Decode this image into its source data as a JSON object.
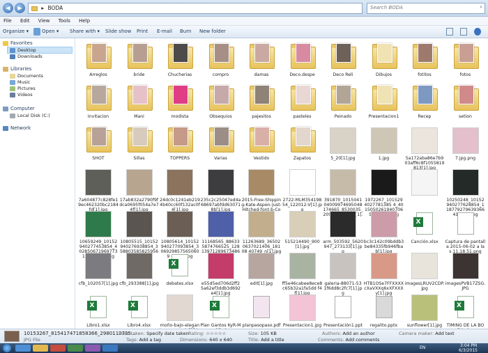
{
  "address": {
    "path_root": "▸",
    "folder": "BODA",
    "search_placeholder": "Search BODA"
  },
  "menu": [
    "File",
    "Edit",
    "View",
    "Tools",
    "Help"
  ],
  "toolbar": [
    "Organize ▾",
    "Open ▾",
    "Share with ▾",
    "Slide show",
    "Print",
    "E-mail",
    "Burn",
    "New folder"
  ],
  "sidebar": {
    "favorites": "Favorites",
    "fav_items": [
      "Desktop",
      "Downloads"
    ],
    "libraries": "Libraries",
    "lib_items": [
      "Documents",
      "Music",
      "Pictures",
      "Videos"
    ],
    "computer": "Computer",
    "comp_items": [
      "Local Disk (C:)"
    ],
    "network": "Network"
  },
  "files": [
    {
      "name": "Arreglos",
      "kind": "folder",
      "color": "#c9a58f"
    },
    {
      "name": "bride",
      "kind": "folder",
      "color": "#b69f92"
    },
    {
      "name": "Chucherias",
      "kind": "folder",
      "color": "#4d4a4a"
    },
    {
      "name": "compro",
      "kind": "folder",
      "color": "#a88f86"
    },
    {
      "name": "damas",
      "kind": "folder",
      "color": "#caa9a2"
    },
    {
      "name": "Deco.despe",
      "kind": "folder",
      "color": "#d88aa0"
    },
    {
      "name": "Deco Reli",
      "kind": "folder",
      "color": "#6e6157"
    },
    {
      "name": "Dibujos",
      "kind": "folder",
      "color": "#f1e2b3"
    },
    {
      "name": "fotitos",
      "kind": "folder",
      "color": "#9d7a6c"
    },
    {
      "name": "fotos",
      "kind": "folder",
      "color": "#c99f93"
    },
    {
      "name": "Invitacion",
      "kind": "folder",
      "color": "#b7a79c"
    },
    {
      "name": "Mani",
      "kind": "folder",
      "color": "#e6c1c7"
    },
    {
      "name": "modista",
      "kind": "folder",
      "color": "#e03d86"
    },
    {
      "name": "Obsequios",
      "kind": "folder",
      "color": "#c7a9a9"
    },
    {
      "name": "pajesitos",
      "kind": "folder",
      "color": "#8f8276"
    },
    {
      "name": "pasteles",
      "kind": "folder",
      "color": "#e9d7d3"
    },
    {
      "name": "Peinado",
      "kind": "folder",
      "color": "#b3a596"
    },
    {
      "name": "Presentacion1",
      "kind": "folder",
      "color": "#efe3b5"
    },
    {
      "name": "Recep",
      "kind": "folder",
      "color": "#7e99c1"
    },
    {
      "name": "setion",
      "kind": "folder",
      "color": "#d08a8a"
    },
    {
      "name": "SHOT",
      "kind": "folder",
      "color": "#b8a298"
    },
    {
      "name": "Sillas",
      "kind": "folder",
      "color": "#d6cbbd"
    },
    {
      "name": "TOPPERS",
      "kind": "folder",
      "color": "#c59a88"
    },
    {
      "name": "Varias",
      "kind": "folder",
      "color": "#9c8e86"
    },
    {
      "name": "Vestido",
      "kind": "folder",
      "color": "#d9b0a8"
    },
    {
      "name": "Zapatos",
      "kind": "folder",
      "color": "#e2d6cd"
    },
    {
      "name": "5_20[1].jpg",
      "kind": "photo",
      "color": "#d9d2c7"
    },
    {
      "name": "1.jpg",
      "kind": "photo",
      "color": "#cfc7b6"
    },
    {
      "name": "5a172aba86e7b903aff6c8f1055819813[1].jpg",
      "kind": "photo",
      "color": "#ebe5dd"
    },
    {
      "name": "7.jpg.png",
      "kind": "photo",
      "color": "#e3c0cc"
    },
    {
      "name": "7a604877c828fe19ec462320bc2184fd[1].jpg",
      "kind": "photo",
      "color": "#5d5f58"
    },
    {
      "name": "17ab832a2790f9fdca0695f054a7e74f[1].jpg",
      "kind": "photo",
      "color": "#b8a58f"
    },
    {
      "name": "24dc0c1241eb2194b40cc60f132ac0f4[1].jpg",
      "kind": "photo",
      "color": "#8b735e"
    },
    {
      "name": "235c2c25047ed4a68697abfdd630718b[1].jpg",
      "kind": "photo",
      "color": "#3d3d40"
    },
    {
      "name": "2015-Free-Shipping-Kate-Aspen-Just-Hitched-font-b-Cowboy-b-f...",
      "kind": "photo",
      "color": "#a88b66"
    },
    {
      "name": "2722-MLM35419854_122012-V[1].jpg",
      "kind": "photo",
      "color": "#ffffff"
    },
    {
      "name": "391870_101504104009974695048174665_8530035_2094974311_n[1].jpg",
      "kind": "photo",
      "color": "#c6bba9"
    },
    {
      "name": "1972267_1015294027781385 4_40150502619407065934_n[1].jpg",
      "kind": "photo",
      "color": "#1a1a1a"
    },
    {
      "name": "",
      "kind": "photo",
      "color": "#f5f5f5"
    },
    {
      "name": "10250248_10152940277628854_118779279639366417n[1].jpg",
      "kind": "photo",
      "color": "#232a28"
    },
    {
      "name": "10659249_10152940277453854_402850671969773102_8_n[1].jpg",
      "kind": "photo",
      "color": "#2f7a4a"
    },
    {
      "name": "10805515_10152940276938854_3588035858259565 6_n[1].jpg",
      "kind": "photo",
      "color": "#5a5550"
    },
    {
      "name": "10805614_10152940277093854_3069298575650609 1_n[1].jpg",
      "kind": "photo",
      "color": "#6b5f55"
    },
    {
      "name": "11168565_886335874766525_12813971289673486_n[1].jpg",
      "kind": "photo",
      "color": "#4f5fa8"
    },
    {
      "name": "11263689_365020637021406_18108 40749_n[1].jpg",
      "kind": "photo",
      "color": "#c2ae8d"
    },
    {
      "name": "515214490_900[1].jpg",
      "kind": "photo",
      "color": "#d9cfb8"
    },
    {
      "name": "arm_503592_5620947_273133[1].jpg",
      "kind": "photo",
      "color": "#2b2b2b"
    },
    {
      "name": "bc3c142c09bddb3be84335fb946fbab[1].jpg",
      "kind": "photo",
      "color": "#cc9ca8"
    },
    {
      "name": "Canción.xlsx",
      "kind": "xls",
      "color": "#1f7a3a"
    },
    {
      "name": "Captura de pantalla 2015-06-02 a las 11.18.51.png",
      "kind": "doc",
      "color": "#ffffff"
    },
    {
      "name": "cfb_102057[1].jpg",
      "kind": "photo",
      "color": "#7c7c80"
    },
    {
      "name": "cfb_293388[1].jpg",
      "kind": "photo",
      "color": "#6f6a66"
    },
    {
      "name": "debates.xlsx",
      "kind": "xls",
      "color": "#1f7a3a"
    },
    {
      "name": "e55d5ed706d2ff25a62ef3ddb3d692e4[1].jpg",
      "kind": "photo",
      "color": "#c43c6a"
    },
    {
      "name": "edit[1].jpg",
      "kind": "photo",
      "color": "#b7a6a0"
    },
    {
      "name": "ff5e46cabee8ece8c65b32a1fa5dd f4f[1].jpg",
      "kind": "photo",
      "color": "#a9b3a2"
    },
    {
      "name": "galeria-88071-53 1f6dd8c2fc7[1].jpg",
      "kind": "photo",
      "color": "#c9c3c0"
    },
    {
      "name": "HTB1OSe7FFXXXXcXaVXXq6xXFXXXy[1].jpg",
      "kind": "photo",
      "color": "#d89a86"
    },
    {
      "name": "imagesLRUV2CDP.jpg",
      "kind": "photo",
      "color": "#e8e4dc"
    },
    {
      "name": "imagesPVB17ZSG.JPG",
      "kind": "photo",
      "color": "#3b3432"
    },
    {
      "name": "Libro1.xlsx",
      "kind": "xls",
      "color": "#1f7a3a"
    },
    {
      "name": "Libro4.xlsx",
      "kind": "xls",
      "color": "#1f7a3a"
    },
    {
      "name": "moño-bajo-elegante-para-novia[1].jpg",
      "kind": "photo",
      "color": "#e2d8d2"
    },
    {
      "name": "Plan Gantos KyR-May15.xlsx",
      "kind": "xls",
      "color": "#1f7a3a"
    },
    {
      "name": "planpasopaso.pdf",
      "kind": "doc",
      "color": "#f3e5f0"
    },
    {
      "name": "Presentacion1.jpg",
      "kind": "photo",
      "color": "#f3c4d5"
    },
    {
      "name": "Presentación1.pptx",
      "kind": "doc",
      "color": "#ffffff"
    },
    {
      "name": "regalito.pptx",
      "kind": "doc",
      "color": "#d9d9d9"
    },
    {
      "name": "sunflower[1].jpg",
      "kind": "photo",
      "color": "#b9c07a"
    },
    {
      "name": "TIMING DE LA BODA.xlsx",
      "kind": "xls",
      "color": "#1f7a3a"
    }
  ],
  "details": {
    "filename": "10153267_815417471858366_2980112725...",
    "filetype": "JPG File",
    "date_taken_k": "Date taken:",
    "date_taken_v": "Specify date taken",
    "tags_k": "Tags:",
    "tags_v": "Add a tag",
    "rating_k": "Rating:",
    "rating_v": "☆☆☆☆☆",
    "dims_k": "Dimensions:",
    "dims_v": "640 x 640",
    "size_k": "Size:",
    "size_v": "105 KB",
    "title_k": "Title:",
    "title_v": "Add a title",
    "authors_k": "Authors:",
    "authors_v": "Add an author",
    "comments_k": "Comments:",
    "comments_v": "Add comments",
    "camera_k": "Camera maker:",
    "camera_v": "Add text"
  },
  "taskbar": {
    "lang": "EN",
    "time": "3:04 PM",
    "date": "6/3/2015"
  }
}
